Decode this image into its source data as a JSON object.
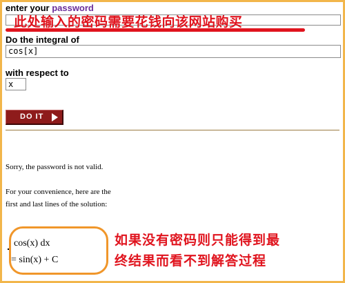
{
  "form": {
    "password_label_prefix": "enter your ",
    "password_link_text": "password",
    "password_value": "",
    "integral_label": "Do the integral of",
    "integral_value": "cos[x]",
    "respect_label": "with respect to",
    "variable_value": "x",
    "submit_label": "DO IT"
  },
  "result": {
    "message": "Sorry, the password is not valid.",
    "convenience_line1": "For your convenience, here are the",
    "convenience_line2": "first and last lines of the solution:",
    "first_line": "cos(x) dx",
    "last_line": "= sin(x) + C"
  },
  "annotations": {
    "password_note": "此处输入的密码需要花钱向该网站购买",
    "result_note_line1": "如果没有密码则只能得到最",
    "result_note_line2": "终结果而看不到解答过程",
    "note_color": "#e0141e",
    "oval_color": "#f0962a",
    "frame_color": "#f2b64a"
  },
  "colors": {
    "button_bg": "#8e1b1b",
    "link_color": "#6a2e9a"
  }
}
